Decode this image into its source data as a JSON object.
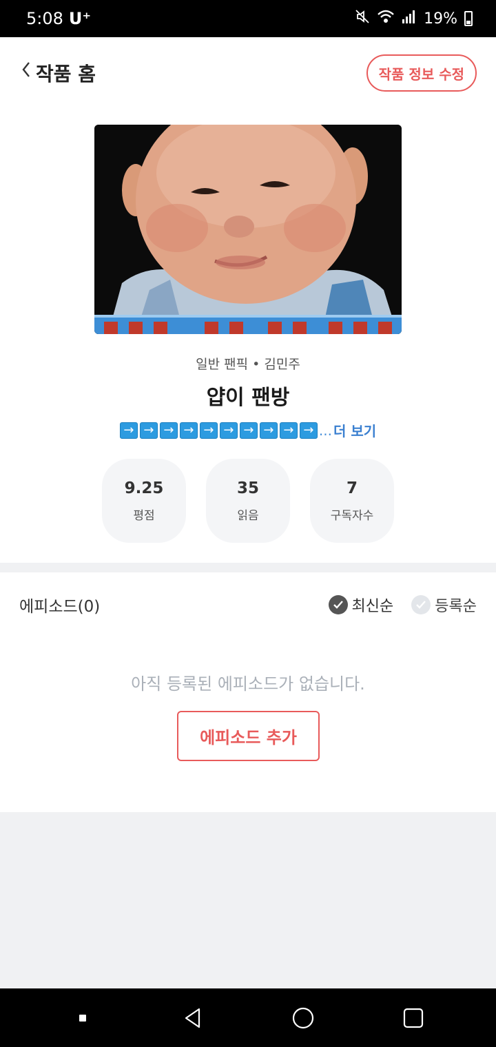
{
  "status_bar": {
    "time": "5:08",
    "carrier": "U⁺",
    "battery": "19%"
  },
  "header": {
    "back_label": "작품 홈",
    "edit_button": "작품 정보 수정"
  },
  "work": {
    "category": "일반 팬픽",
    "author": "김민주",
    "title": "얍이 팬방",
    "synopsis_arrow_count": 10,
    "synopsis_arrow": "➡",
    "synopsis_ellipsis": "...",
    "more_label": "더 보기"
  },
  "stats": [
    {
      "value": "9.25",
      "label": "평점"
    },
    {
      "value": "35",
      "label": "읽음"
    },
    {
      "value": "7",
      "label": "구독자수"
    }
  ],
  "episodes": {
    "title": "에피소드(0)",
    "sort_options": [
      {
        "label": "최신순",
        "selected": true
      },
      {
        "label": "등록순",
        "selected": false
      }
    ],
    "empty_message": "아직 등록된 에피소드가 없습니다.",
    "add_button": "에피소드 추가"
  },
  "colors": {
    "accent": "#e85a5a",
    "link": "#3a7fd0",
    "arrow_blue": "#2d9be0"
  },
  "icons": {
    "back": "chevron-left-icon",
    "mute": "mute-icon",
    "wifi": "wifi-icon",
    "signal": "signal-icon",
    "battery": "battery-icon",
    "check": "check-icon",
    "nav_recent": "square-dot-icon",
    "nav_back": "triangle-back-icon",
    "nav_home": "circle-home-icon",
    "nav_overview": "square-overview-icon"
  }
}
